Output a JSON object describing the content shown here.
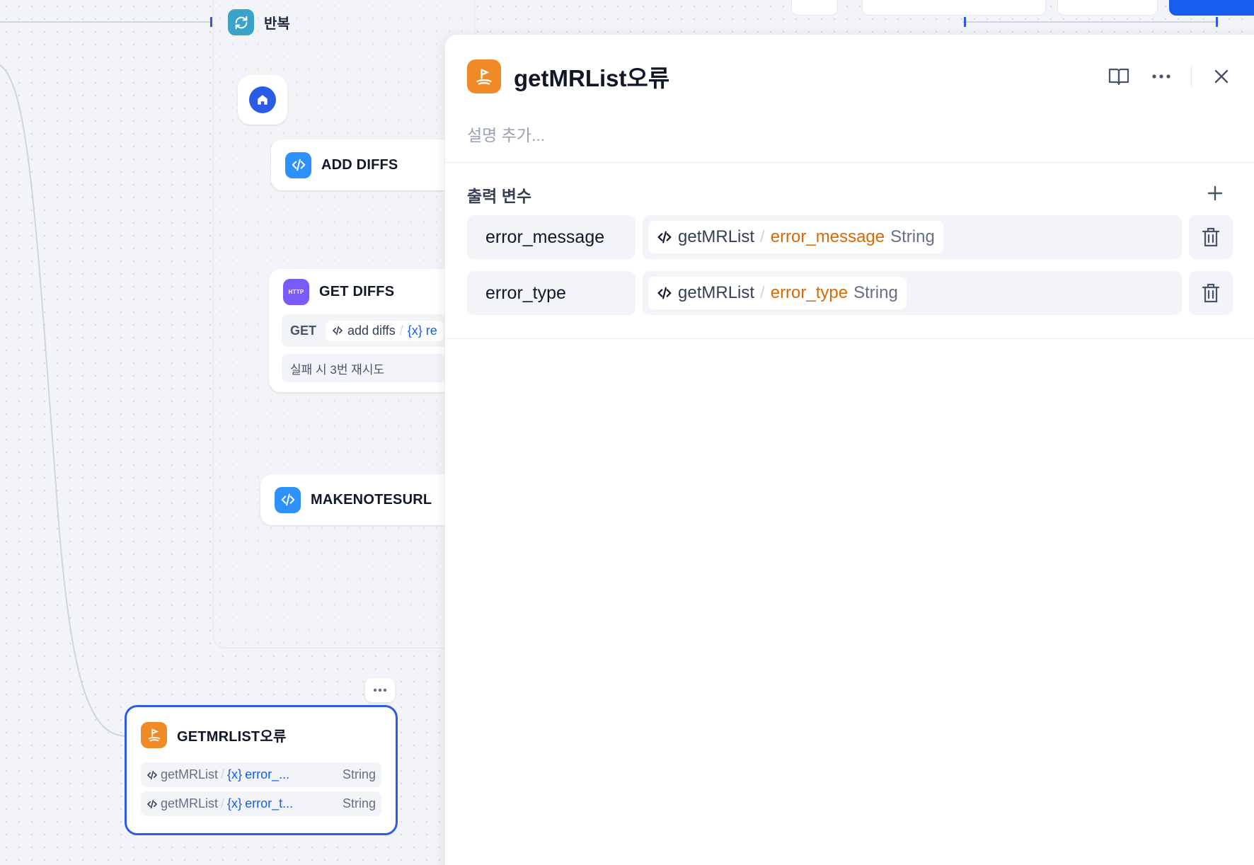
{
  "colors": {
    "accent": "#155eef",
    "variable_orange": "#dc6803",
    "node_orange": "#f08a24",
    "node_blue": "#2e90fa",
    "node_purple": "#7a5af8",
    "node_teal": "#3aa3c9"
  },
  "canvas": {
    "loop": {
      "title": "반복",
      "icon": "loop-icon"
    },
    "nodes": {
      "add_diffs": {
        "title": "ADD DIFFS",
        "icon": "code-icon"
      },
      "get_diffs": {
        "title": "GET DIFFS",
        "icon_text": "HTTP",
        "method": "GET",
        "source": "add diffs",
        "var_fragment": "{x} re",
        "retry": "실패 시 3번 재시도"
      },
      "make_notes": {
        "title": "MAKENOTESURL",
        "icon": "code-icon"
      },
      "end": {
        "title": "GETMRLIST오류",
        "icon": "end-icon",
        "outputs": [
          {
            "source": "getMRList",
            "var_icon": "{x}",
            "var": "error_...",
            "type": "String"
          },
          {
            "source": "getMRList",
            "var_icon": "{x}",
            "var": "error_t...",
            "type": "String"
          }
        ]
      }
    }
  },
  "panel": {
    "title": "getMRList오류",
    "description_placeholder": "설명 추가...",
    "section_title": "출력 변수",
    "variables": [
      {
        "name": "error_message",
        "source": "getMRList",
        "var": "error_message",
        "type": "String"
      },
      {
        "name": "error_type",
        "source": "getMRList",
        "var": "error_type",
        "type": "String"
      }
    ]
  }
}
